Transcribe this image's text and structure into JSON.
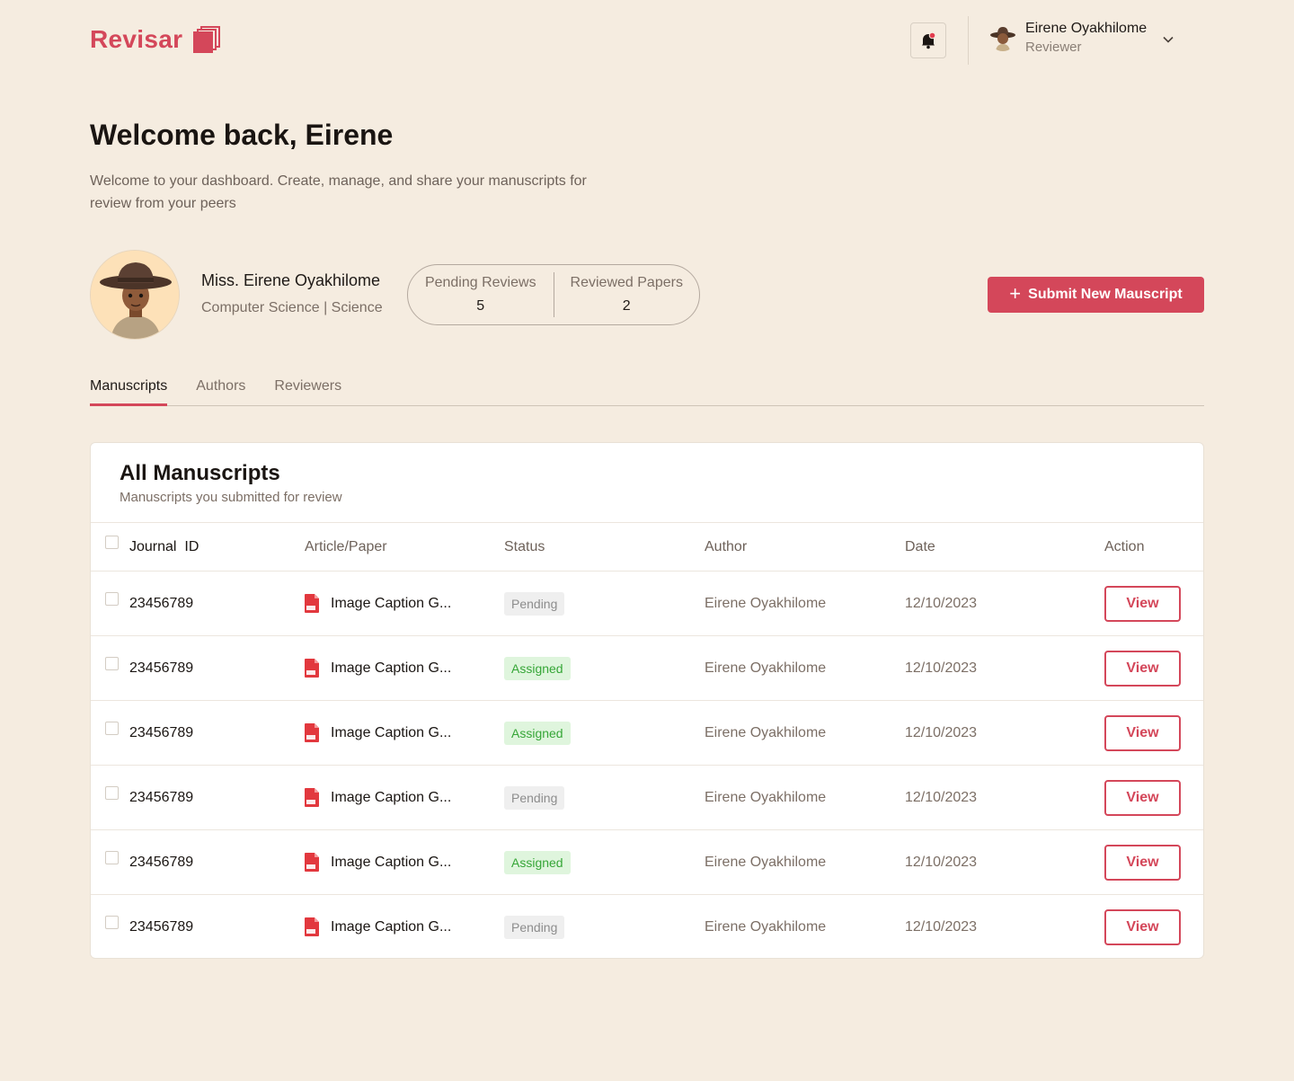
{
  "brand": {
    "name": "Revisar",
    "accent": "#d4475a"
  },
  "header": {
    "user_name": "Eirene Oyakhilome",
    "user_role": "Reviewer"
  },
  "welcome": {
    "title": "Welcome back, Eirene",
    "subtitle": "Welcome to your dashboard. Create, manage, and share your manuscripts for review from your peers"
  },
  "profile": {
    "name": "Miss. Eirene Oyakhilome",
    "department": "Computer Science | Science"
  },
  "stats": [
    {
      "label": "Pending Reviews",
      "value": "5"
    },
    {
      "label": "Reviewed Papers",
      "value": "2"
    }
  ],
  "actions": {
    "submit_label": "Submit New Mauscript"
  },
  "tabs": [
    {
      "label": "Manuscripts",
      "active": true
    },
    {
      "label": "Authors",
      "active": false
    },
    {
      "label": "Reviewers",
      "active": false
    }
  ],
  "card": {
    "title": "All Manuscripts",
    "subtitle": "Manuscripts you submitted for review"
  },
  "table": {
    "columns": [
      "Journal  ID",
      "Article/Paper",
      "Status",
      "Author",
      "Date",
      "Action"
    ],
    "rows": [
      {
        "id": "23456789",
        "article": "Image Caption G...",
        "status": "Pending",
        "author": "Eirene Oyakhilome",
        "date": "12/10/2023",
        "action": "View"
      },
      {
        "id": "23456789",
        "article": "Image Caption G...",
        "status": "Assigned",
        "author": "Eirene Oyakhilome",
        "date": "12/10/2023",
        "action": "View"
      },
      {
        "id": "23456789",
        "article": "Image Caption G...",
        "status": "Assigned",
        "author": "Eirene Oyakhilome",
        "date": "12/10/2023",
        "action": "View"
      },
      {
        "id": "23456789",
        "article": "Image Caption G...",
        "status": "Pending",
        "author": "Eirene Oyakhilome",
        "date": "12/10/2023",
        "action": "View"
      },
      {
        "id": "23456789",
        "article": "Image Caption G...",
        "status": "Assigned",
        "author": "Eirene Oyakhilome",
        "date": "12/10/2023",
        "action": "View"
      },
      {
        "id": "23456789",
        "article": "Image Caption G...",
        "status": "Pending",
        "author": "Eirene Oyakhilome",
        "date": "12/10/2023",
        "action": "View"
      }
    ]
  },
  "icons": {
    "logo": "stacked-pages-icon",
    "notification": "bell-icon",
    "dropdown": "chevron-down-icon",
    "file": "pdf-file-icon",
    "add": "plus-icon"
  }
}
